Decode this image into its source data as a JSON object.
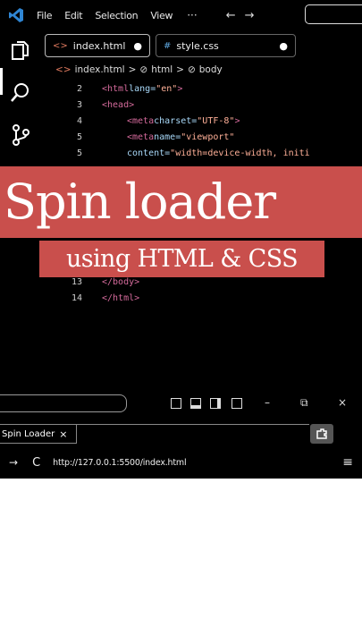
{
  "menubar": {
    "items": [
      "File",
      "Edit",
      "Selection",
      "View"
    ],
    "more": "···",
    "back": "←",
    "forward": "→"
  },
  "tabs": [
    {
      "label": "index.html",
      "modified": "●"
    },
    {
      "label": "style.css",
      "modified": "●"
    }
  ],
  "breadcrumb": {
    "file": "index.html",
    "sep1": ">",
    "el1": "html",
    "sep2": ">",
    "el2": "body"
  },
  "code": {
    "lines": [
      {
        "num": "2",
        "parts": [
          [
            "tag",
            "<html "
          ],
          [
            "attr",
            "lang="
          ],
          [
            "val",
            "\"en\""
          ],
          [
            "tag",
            ">"
          ]
        ],
        "indent": 0
      },
      {
        "num": "3",
        "parts": [
          [
            "tag",
            "<head>"
          ]
        ],
        "indent": 0
      },
      {
        "num": "4",
        "parts": [
          [
            "tag",
            "<meta "
          ],
          [
            "attr",
            "charset="
          ],
          [
            "val",
            "\"UTF-8\""
          ],
          [
            "tag",
            ">"
          ]
        ],
        "indent": 1
      },
      {
        "num": "5",
        "parts": [
          [
            "tag",
            "<meta "
          ],
          [
            "attr",
            "name="
          ],
          [
            "val",
            "\"viewport\""
          ]
        ],
        "indent": 1
      },
      {
        "num": "5",
        "parts": [
          [
            "attr",
            "content="
          ],
          [
            "val",
            "\"width=device-width, initi"
          ]
        ],
        "indent": 1
      },
      {
        "num": "13",
        "parts": [
          [
            "tag",
            "</body>"
          ]
        ],
        "indent": 0
      },
      {
        "num": "14",
        "parts": [
          [
            "tag",
            "</html>"
          ]
        ],
        "indent": 0
      }
    ]
  },
  "overlay": {
    "title": "Spin loader",
    "subtitle": "using HTML & CSS"
  },
  "panel": {
    "minimize": "–",
    "restore": "⧉",
    "close": "×"
  },
  "browser": {
    "tab_label": "Spin Loader",
    "tab_close": "×",
    "back": "→",
    "reload": "C",
    "url": "http://127.0.0.1:5500/index.html",
    "menu": "≡"
  },
  "colors": {
    "band": "#c94f4c",
    "background": "#000000"
  }
}
